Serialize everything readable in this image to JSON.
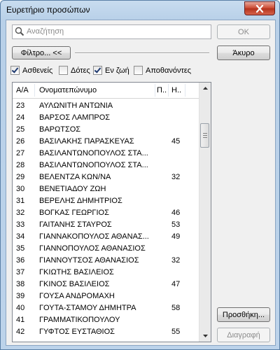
{
  "window": {
    "title": "Ευρετήριο προσώπων"
  },
  "search": {
    "placeholder": "Αναζήτηση",
    "value": ""
  },
  "buttons": {
    "ok": "ΟΚ",
    "filter": "Φίλτρο... <<",
    "cancel": "Άκυρο",
    "add": "Προσθήκη...",
    "delete": "Διαγραφή"
  },
  "filters": [
    {
      "label": "Ασθενείς",
      "checked": true
    },
    {
      "label": "Δότες",
      "checked": false
    },
    {
      "label": "Εν ζωή",
      "checked": true
    },
    {
      "label": "Αποθανόντες",
      "checked": false
    }
  ],
  "table": {
    "columns": [
      "Α/Α",
      "Ονοματεπώνυμο",
      "Π..",
      "Η.."
    ],
    "rows": [
      {
        "id": "23",
        "name": "ΑΥΛΩΝΙΤΗ ΑΝΤΩΝΙΑ",
        "age": ""
      },
      {
        "id": "24",
        "name": "ΒΑΡΣΟΣ ΛΑΜΠΡΟΣ",
        "age": ""
      },
      {
        "id": "25",
        "name": "ΒΑΡΩΤΣΟΣ",
        "age": ""
      },
      {
        "id": "26",
        "name": "ΒΑΣΙΛΑΚΗΣ ΠΑΡΑΣΚΕΥΑΣ",
        "age": "45"
      },
      {
        "id": "27",
        "name": "ΒΑΣΙΛΑΝΤΩΝΟΠΟΥΛΟΣ ΣΤΑ...",
        "age": ""
      },
      {
        "id": "28",
        "name": "ΒΑΣΙΛΑΝΤΩΝΟΠΟΥΛΟΣ ΣΤΑ...",
        "age": ""
      },
      {
        "id": "29",
        "name": "ΒΕΛΕΝΤΖΑ ΚΩΝ/ΝΑ",
        "age": "32"
      },
      {
        "id": "30",
        "name": "ΒΕΝΕΤΙΑΔΟΥ ΖΩΗ",
        "age": ""
      },
      {
        "id": "31",
        "name": "ΒΕΡΕΛΗΣ ΔΗΜΗΤΡΙΟΣ",
        "age": ""
      },
      {
        "id": "32",
        "name": "ΒΟΓΚΑΣ ΓΕΩΡΓΙΟΣ",
        "age": "46"
      },
      {
        "id": "33",
        "name": "ΓΑΙΤΑΝΗΣ ΣΤΑΥΡΟΣ",
        "age": "53"
      },
      {
        "id": "34",
        "name": "ΓΙΑΝΝΑΚΟΠΟΥΛΟΣ ΑΘΑΝΑΣ...",
        "age": "49"
      },
      {
        "id": "35",
        "name": "ΓΙΑΝΝΟΠΟΥΛΟΣ ΑΘΑΝΑΣΙΟΣ",
        "age": ""
      },
      {
        "id": "36",
        "name": "ΓΙΑΝΝΟΥΤΣΟΣ ΑΘΑΝΑΣΙΟΣ",
        "age": "32"
      },
      {
        "id": "37",
        "name": "ΓΚΙΩΤΗΣ ΒΑΣΙΛΕΙΟΣ",
        "age": ""
      },
      {
        "id": "38",
        "name": "ΓΚΙΝΟΣ ΒΑΣΙΛΕΙΟΣ",
        "age": "47"
      },
      {
        "id": "39",
        "name": "ΓΟΥΣΑ ΑΝΔΡΟΜΑΧΗ",
        "age": ""
      },
      {
        "id": "40",
        "name": "ΓΟΥΤΑ-ΣΤΑΜΟΥ ΔΗΜΗΤΡΑ",
        "age": "58"
      },
      {
        "id": "41",
        "name": "ΓΡΑΜΜΑΤΙΚΟΠΟΥΛΟΥ",
        "age": ""
      },
      {
        "id": "42",
        "name": "ΓΥΦΤΟΣ ΕΥΣΤΑΘΙΟΣ",
        "age": "55"
      }
    ]
  },
  "icons": {
    "close": "close-icon",
    "search": "search-icon",
    "scroll_up": "arrow-up-icon",
    "scroll_down": "arrow-down-icon"
  }
}
